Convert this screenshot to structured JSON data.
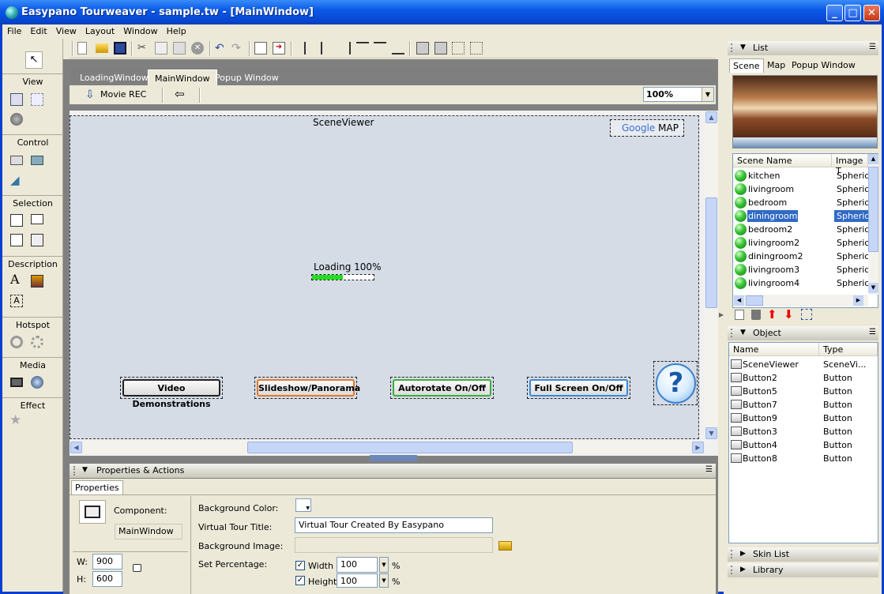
{
  "window": {
    "title": "Easypano Tourweaver - sample.tw - [MainWindow]",
    "controls": {
      "minimize": "_",
      "maximize": "□",
      "close": "✕"
    }
  },
  "menu": [
    "File",
    "Edit",
    "View",
    "Layout",
    "Window",
    "Help"
  ],
  "palette": {
    "groups": [
      "View",
      "Control",
      "Selection",
      "Description",
      "Hotspot",
      "Media",
      "Effect"
    ]
  },
  "tabs": [
    "LoadingWindow",
    "MainWindow",
    "Popup Window"
  ],
  "active_tab": "MainWindow",
  "subbar": {
    "movie_rec": "Movie REC",
    "zoom": "100%"
  },
  "canvas": {
    "scene_viewer_label": "SceneViewer",
    "google_word": "Google",
    "google_map": "MAP",
    "loading_text": "Loading 100%",
    "loading_progress": 0.5,
    "buttons": [
      "Video Demonstrations",
      "Slideshow/Panorama",
      "Autorotate On/Off",
      "Full Screen On/Off"
    ],
    "button_colors": [
      "#222222",
      "#e07a2e",
      "#3cae3c",
      "#3a88d6"
    ],
    "help_symbol": "?"
  },
  "properties": {
    "header": "Properties & Actions",
    "tab": "Properties",
    "component_label": "Component:",
    "component_value": "MainWindow",
    "w_label": "W:",
    "w_value": "900",
    "h_label": "H:",
    "h_value": "600",
    "background_color_label": "Background Color:",
    "title_label": "Virtual Tour Title:",
    "title_value": "Virtual Tour Created By Easypano",
    "background_image_label": "Background Image:",
    "set_percentage_label": "Set Percentage:",
    "width_label": "Width",
    "width_value": "100",
    "height_label": "Height",
    "height_value": "100",
    "percent": "%"
  },
  "list_panel": {
    "header": "List",
    "tabs": [
      "Scene",
      "Map",
      "Popup Window"
    ],
    "columns": [
      "Scene Name",
      "Image T"
    ],
    "scenes": [
      {
        "name": "kitchen",
        "type": "Spherical"
      },
      {
        "name": "livingroom",
        "type": "Spherical"
      },
      {
        "name": "bedroom",
        "type": "Spherical"
      },
      {
        "name": "diningroom",
        "type": "Spherical"
      },
      {
        "name": "bedroom2",
        "type": "Spherical"
      },
      {
        "name": "livingroom2",
        "type": "Spherical"
      },
      {
        "name": "diningroom2",
        "type": "Spherical"
      },
      {
        "name": "livingroom3",
        "type": "Spherical"
      },
      {
        "name": "livingroom4",
        "type": "Spherical"
      }
    ],
    "selected_scene": "diningroom"
  },
  "object_panel": {
    "header": "Object",
    "columns": [
      "Name",
      "Type"
    ],
    "objects": [
      {
        "name": "SceneViewer",
        "type": "SceneVi..."
      },
      {
        "name": "Button2",
        "type": "Button"
      },
      {
        "name": "Button5",
        "type": "Button"
      },
      {
        "name": "Button7",
        "type": "Button"
      },
      {
        "name": "Button9",
        "type": "Button"
      },
      {
        "name": "Button3",
        "type": "Button"
      },
      {
        "name": "Button4",
        "type": "Button"
      },
      {
        "name": "Button8",
        "type": "Button"
      }
    ]
  },
  "skin_list": "Skin List",
  "library": "Library"
}
